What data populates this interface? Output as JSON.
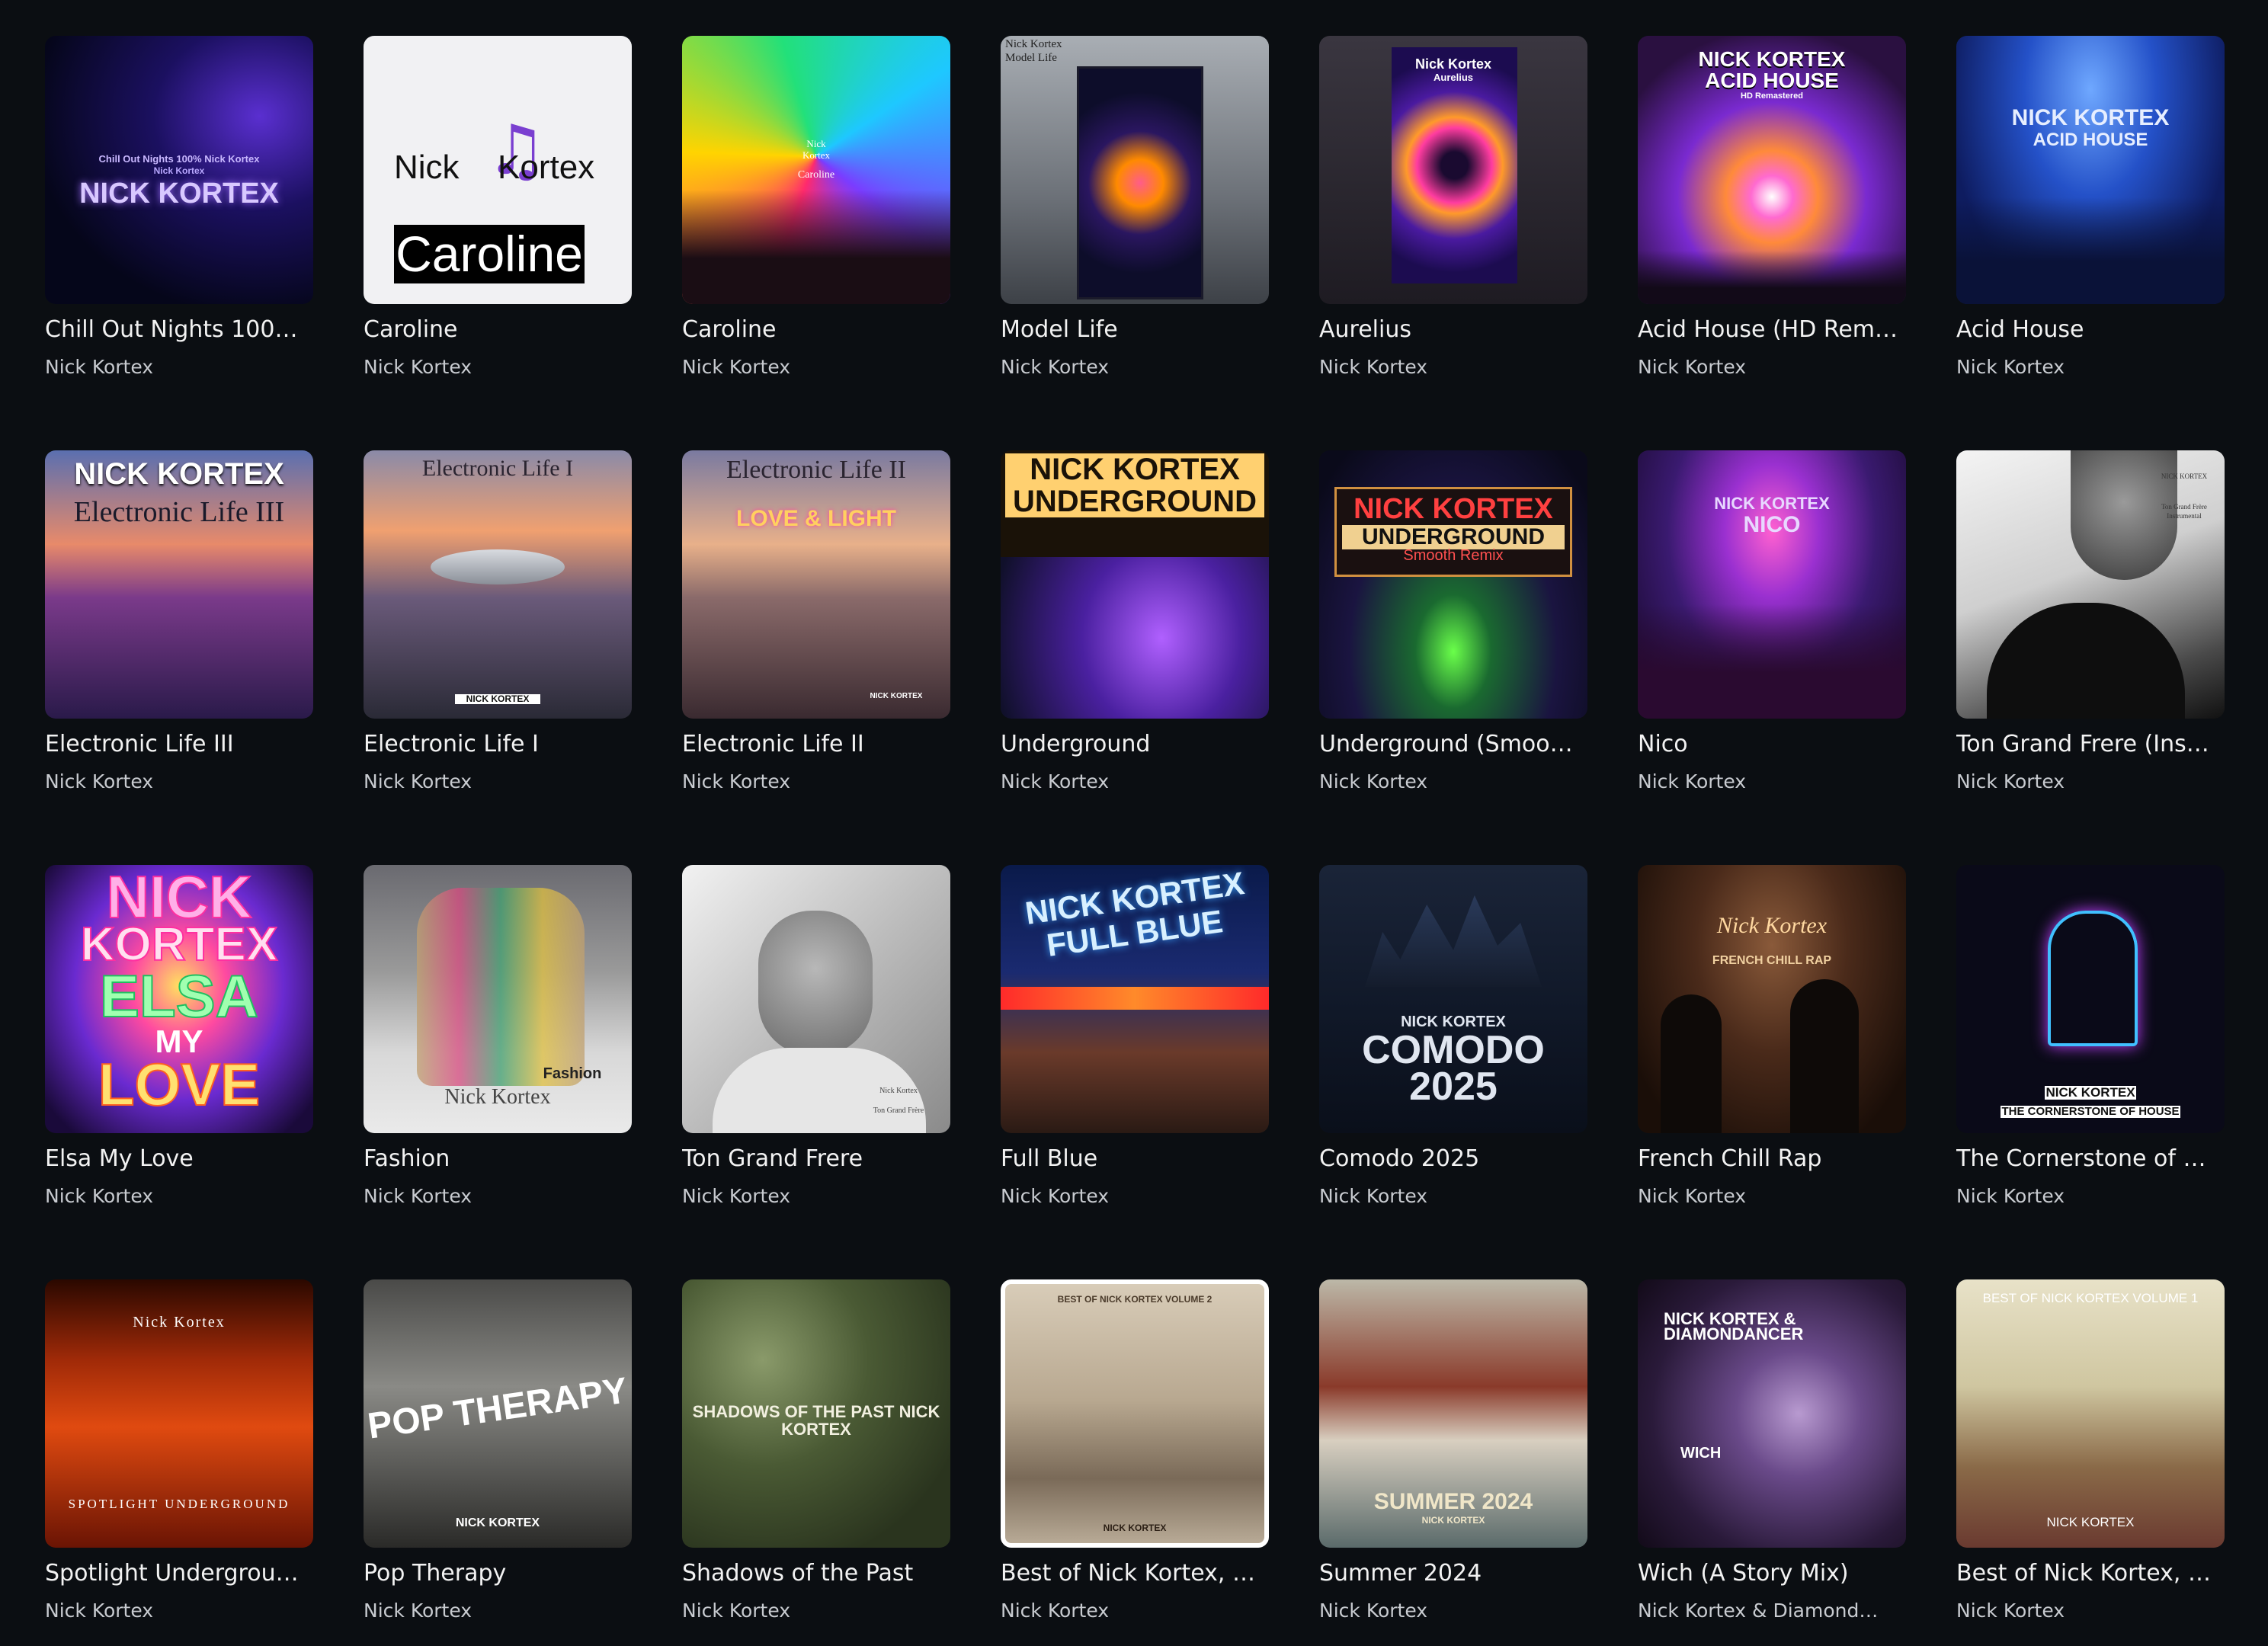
{
  "albums": [
    {
      "title": "Chill Out Nights 100…",
      "artist": "Nick Kortex",
      "cover_text": [
        "Chill Out Nights 100% Nick Kortex",
        "Nick Kortex",
        "NICK KORTEX"
      ]
    },
    {
      "title": "Caroline",
      "artist": "Nick Kortex",
      "cover_text": [
        "Nick",
        "Kortex",
        "Caroline"
      ]
    },
    {
      "title": "Caroline",
      "artist": "Nick Kortex",
      "cover_text": [
        "Nick",
        "Kortex",
        "Caroline"
      ]
    },
    {
      "title": "Model Life",
      "artist": "Nick Kortex",
      "cover_text": [
        "Nick Kortex",
        "Model Life"
      ]
    },
    {
      "title": "Aurelius",
      "artist": "Nick Kortex",
      "cover_text": [
        "Nick Kortex",
        "Aurelius"
      ]
    },
    {
      "title": "Acid House (HD Rem…",
      "artist": "Nick Kortex",
      "cover_text": [
        "NICK KORTEX",
        "ACID HOUSE",
        "HD Remastered"
      ]
    },
    {
      "title": "Acid House",
      "artist": "Nick Kortex",
      "cover_text": [
        "NICK KORTEX",
        "ACID HOUSE"
      ]
    },
    {
      "title": "Electronic Life III",
      "artist": "Nick Kortex",
      "cover_text": [
        "NICK KORTEX",
        "Electronic Life III"
      ]
    },
    {
      "title": "Electronic Life I",
      "artist": "Nick Kortex",
      "cover_text": [
        "Electronic Life I",
        "NICK KORTEX"
      ]
    },
    {
      "title": "Electronic Life II",
      "artist": "Nick Kortex",
      "cover_text": [
        "Electronic Life II",
        "LOVE & LIGHT",
        "NICK KORTEX"
      ]
    },
    {
      "title": "Underground",
      "artist": "Nick Kortex",
      "cover_text": [
        "NICK KORTEX",
        "UNDERGROUND"
      ]
    },
    {
      "title": "Underground (Smoo…",
      "artist": "Nick Kortex",
      "cover_text": [
        "NICK KORTEX",
        "UNDERGROUND",
        "Smooth Remix"
      ]
    },
    {
      "title": "Nico",
      "artist": "Nick Kortex",
      "cover_text": [
        "NICK KORTEX",
        "NICO"
      ]
    },
    {
      "title": "Ton Grand Frere (Ins…",
      "artist": "Nick Kortex",
      "cover_text": [
        "NICK KORTEX",
        "Ton Grand Frère",
        "Instrumental"
      ]
    },
    {
      "title": "Elsa My Love",
      "artist": "Nick Kortex",
      "cover_text": [
        "NICK",
        "KORTEX",
        "ELSA",
        "MY",
        "LOVE"
      ]
    },
    {
      "title": "Fashion",
      "artist": "Nick Kortex",
      "cover_text": [
        "Fashion",
        "Nick Kortex"
      ]
    },
    {
      "title": "Ton Grand Frere",
      "artist": "Nick Kortex",
      "cover_text": [
        "Nick Kortex",
        "Ton Grand Frère"
      ]
    },
    {
      "title": "Full Blue",
      "artist": "Nick Kortex",
      "cover_text": [
        "NICK KORTEX",
        "FULL BLUE"
      ]
    },
    {
      "title": "Comodo 2025",
      "artist": "Nick Kortex",
      "cover_text": [
        "NICK KORTEX",
        "COMODO",
        "2025"
      ]
    },
    {
      "title": "French Chill Rap",
      "artist": "Nick Kortex",
      "cover_text": [
        "Nick Kortex",
        "FRENCH CHILL RAP"
      ]
    },
    {
      "title": "The Cornerstone of …",
      "artist": "Nick Kortex",
      "cover_text": [
        "NICK KORTEX",
        "THE CORNERSTONE OF HOUSE"
      ]
    },
    {
      "title": "Spotlight Undergrou…",
      "artist": "Nick Kortex",
      "cover_text": [
        "Nick Kortex",
        "SPOTLIGHT UNDERGROUND"
      ]
    },
    {
      "title": "Pop Therapy",
      "artist": "Nick Kortex",
      "cover_text": [
        "POP THERAPY",
        "NICK KORTEX"
      ]
    },
    {
      "title": "Shadows of the Past",
      "artist": "Nick Kortex",
      "cover_text": [
        "SHADOWS OF THE PAST NICK KORTEX"
      ]
    },
    {
      "title": "Best of Nick Kortex, …",
      "artist": "Nick Kortex",
      "cover_text": [
        "BEST OF NICK KORTEX VOLUME 2",
        "NICK KORTEX"
      ]
    },
    {
      "title": "Summer 2024",
      "artist": "Nick Kortex",
      "cover_text": [
        "SUMMER 2024",
        "NICK KORTEX"
      ]
    },
    {
      "title": "Wich (A Story Mix)",
      "artist": "Nick Kortex & Diamond…",
      "cover_text": [
        "NICK KORTEX &",
        "DIAMONDANCER",
        "WICH"
      ]
    },
    {
      "title": "Best of Nick Kortex, …",
      "artist": "Nick Kortex",
      "cover_text": [
        "BEST OF NICK KORTEX VOLUME 1",
        "NICK KORTEX"
      ]
    }
  ]
}
